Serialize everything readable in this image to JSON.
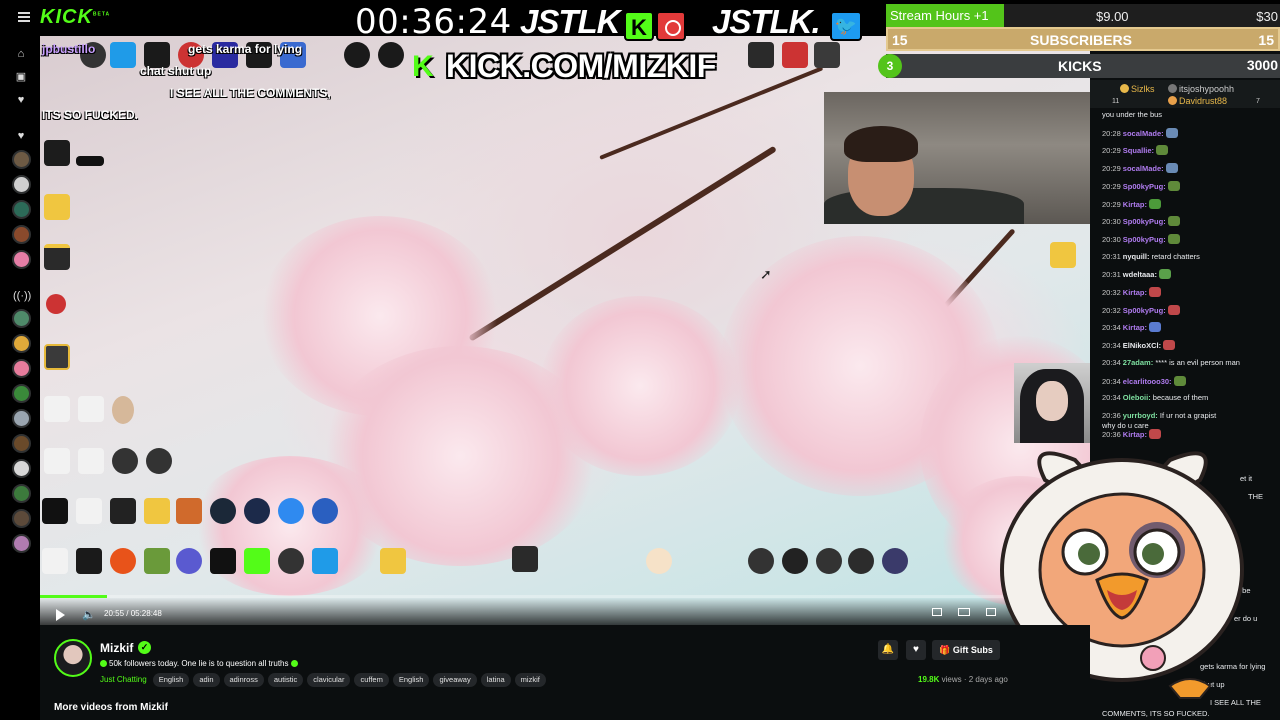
{
  "header": {
    "logo": "KICK",
    "logo_tag": "BETA",
    "timer": "00:36:24",
    "brand_left": "JSTLK",
    "brand_right": "JSTLK.",
    "kick_badge": "K",
    "kick_url": "KICK.COM/MIZKIF"
  },
  "stats": {
    "stream_hours_label": "Stream Hours +1",
    "stream_hours_price": "$9.00",
    "stream_hours_max": "$30",
    "stream_hours_progress": 0.3,
    "subs_left": "15",
    "subs_label": "SUBSCRIBERS",
    "subs_right": "15",
    "kicks_count": "3",
    "kicks_label": "KICKS",
    "kicks_total": "3000"
  },
  "overlay_chat": [
    {
      "user": "jpbustillo",
      "text": "gets karma for lying"
    },
    {
      "user": "",
      "text": "chat shut up"
    },
    {
      "user": "",
      "text": "I SEE ALL THE COMMENTS,"
    },
    {
      "user": "",
      "text": "ITS SO FUCKED."
    }
  ],
  "player": {
    "time": "20:55 / 05:28:48",
    "progress": 0.064
  },
  "chat": {
    "pinned": [
      {
        "name": "Sizlks",
        "color": "#e8b84a"
      },
      {
        "name": "itsjoshypoohh",
        "color": "#ccc"
      },
      {
        "name": "Davidrust88",
        "color": "#e8b84a"
      }
    ],
    "pinned_count_left": "11",
    "pinned_count_right": "7",
    "messages": [
      {
        "ts": "",
        "user": "",
        "color": "#e8eaed",
        "text": "you under the bus",
        "emote": ""
      },
      {
        "ts": "20:28",
        "user": "socalMade:",
        "color": "#b07cf0",
        "text": "",
        "emote": "#6a8bb5"
      },
      {
        "ts": "20:29",
        "user": "Squallie:",
        "color": "#b07cf0",
        "text": "",
        "emote": "#5f8a3a"
      },
      {
        "ts": "20:29",
        "user": "socalMade:",
        "color": "#b07cf0",
        "text": "",
        "emote": "#6a8bb5"
      },
      {
        "ts": "20:29",
        "user": "Sp00kyPug:",
        "color": "#b07cf0",
        "text": "",
        "emote": "#5f8a3a"
      },
      {
        "ts": "20:29",
        "user": "Kirtap:",
        "color": "#b07cf0",
        "text": "",
        "emote": "#4c9a3a"
      },
      {
        "ts": "20:30",
        "user": "Sp00kyPug:",
        "color": "#b07cf0",
        "text": "",
        "emote": "#5f8a3a"
      },
      {
        "ts": "20:30",
        "user": "Sp00kyPug:",
        "color": "#b07cf0",
        "text": "",
        "emote": "#5f8a3a"
      },
      {
        "ts": "20:31",
        "user": "nyquill:",
        "color": "#e8eaed",
        "text": "retard chatters",
        "emote": ""
      },
      {
        "ts": "20:31",
        "user": "wdeltaaa:",
        "color": "#e8eaed",
        "text": "",
        "emote": "#5aa04a"
      },
      {
        "ts": "20:32",
        "user": "Kirtap:",
        "color": "#b07cf0",
        "text": "",
        "emote": "#c0484a"
      },
      {
        "ts": "20:32",
        "user": "Sp00kyPug:",
        "color": "#b07cf0",
        "text": "",
        "emote": "#c0484a"
      },
      {
        "ts": "20:34",
        "user": "Kirtap:",
        "color": "#b07cf0",
        "text": "",
        "emote": "#5a7bd0"
      },
      {
        "ts": "20:34",
        "user": "ElNikoXCl:",
        "color": "#e8eaed",
        "text": "",
        "emote": "#c0484a"
      },
      {
        "ts": "20:34",
        "user": "27adam:",
        "color": "#7ee0a0",
        "text": "**** is an evil person man",
        "emote": ""
      },
      {
        "ts": "20:34",
        "user": "elcarlitooo30:",
        "color": "#b07cf0",
        "text": "",
        "emote": "#5f8a3a"
      },
      {
        "ts": "20:34",
        "user": "Oleboii:",
        "color": "#7ee0a0",
        "text": "because of them",
        "emote": ""
      },
      {
        "ts": "20:36",
        "user": "yurrboyd:",
        "color": "#7ee0a0",
        "text": "If ur not a grapist why do u care",
        "emote": ""
      },
      {
        "ts": "20:36",
        "user": "Kirtap:",
        "color": "#b07cf0",
        "text": "",
        "emote": "#c0484a"
      }
    ],
    "fragments": [
      "et it",
      "THE",
      "ying to be",
      "er do u",
      "gets karma for lying",
      "shut up",
      "I SEE ALL THE",
      "COMMENTS, ITS SO FUCKED."
    ]
  },
  "channel": {
    "name": "Mizkif",
    "title": "50k followers today. One lie is to question all truths",
    "category": "Just Chatting",
    "tags": [
      "English",
      "adin",
      "adinross",
      "autistic",
      "clavicular",
      "cuffem",
      "English",
      "giveaway",
      "latina",
      "mizkif"
    ],
    "gift_subs": "Gift Subs",
    "views": "19.8K",
    "views_suffix": "views",
    "ago": "2 days ago",
    "more_videos": "More videos from Mizkif"
  }
}
